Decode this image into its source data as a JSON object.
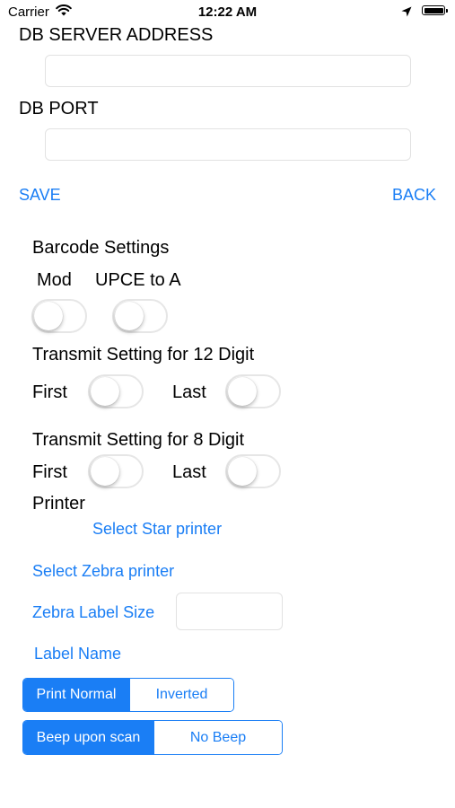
{
  "status_bar": {
    "carrier": "Carrier",
    "time": "12:22 AM",
    "wifi_icon": "wifi-icon",
    "location_icon": "location-arrow-icon",
    "battery_icon": "battery-icon"
  },
  "db": {
    "server_label": "DB SERVER ADDRESS",
    "server_value": "",
    "port_label": "DB PORT",
    "port_value": ""
  },
  "nav": {
    "save": "SAVE",
    "back": "BACK"
  },
  "barcode": {
    "title": "Barcode Settings",
    "mod_label": "Mod",
    "upce_label": "UPCE to A",
    "mod_on": false,
    "upce_on": false
  },
  "transmit12": {
    "title": "Transmit Setting for 12 Digit",
    "first": "First",
    "last": "Last",
    "first_on": false,
    "last_on": false
  },
  "transmit8": {
    "title": "Transmit Setting for 8 Digit",
    "first": "First",
    "last": "Last",
    "first_on": false,
    "last_on": false
  },
  "printer": {
    "title": "Printer",
    "select_star": "Select Star printer",
    "select_zebra": "Select Zebra printer",
    "zebra_label_size": "Zebra Label Size",
    "zebra_label_size_value": "",
    "label_name": "Label Name"
  },
  "print_mode": {
    "options": [
      "Print Normal",
      "Inverted"
    ],
    "selected": "Print Normal"
  },
  "beep_mode": {
    "options": [
      "Beep upon scan",
      "No Beep"
    ],
    "selected": "Beep upon scan"
  },
  "colors": {
    "accent": "#1a7ef5",
    "field_border": "#e2e2e2",
    "toggle_border": "#e6e6e6"
  }
}
